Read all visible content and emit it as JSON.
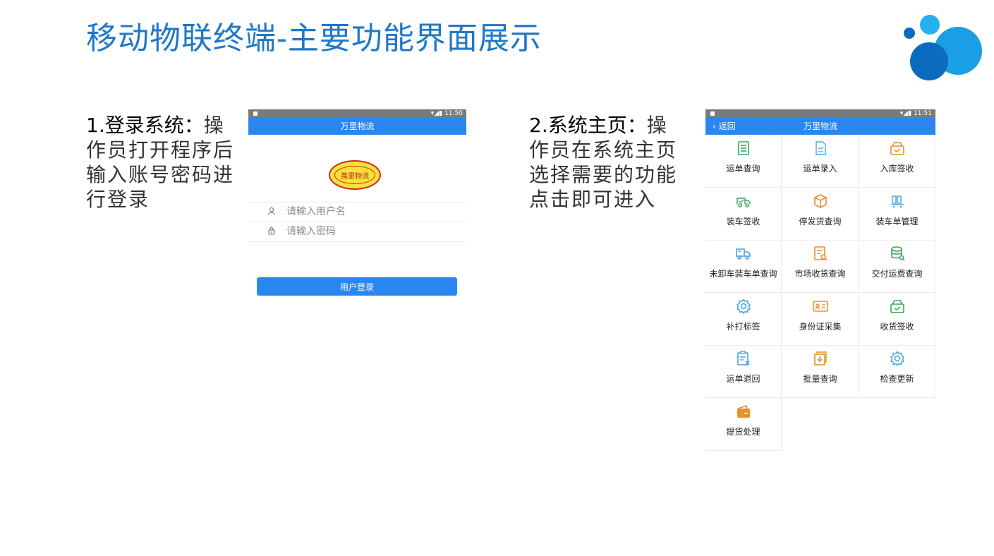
{
  "slide": {
    "title": "移动物联终端-主要功能界面展示"
  },
  "logo": {
    "colors": [
      "#1a9ee6",
      "#0a6bbf",
      "#27b0ef"
    ]
  },
  "section1": {
    "lead": "1.登录系统：",
    "text": "操作员打开程序后输入账号密码进行登录"
  },
  "section2": {
    "lead": "2.系统主页：",
    "text": "操作员在系统主页选择需要的功能点击即可进入"
  },
  "login_screen": {
    "status_time": "11:50",
    "app_title": "万里物流",
    "stamp_text": "萬里物流",
    "username_placeholder": "请输入用户名",
    "password_placeholder": "请输入密码",
    "login_button": "用户登录"
  },
  "home_screen": {
    "status_time": "11:51",
    "back_label": "返回",
    "app_title": "万里物流",
    "menu": [
      {
        "label": "运单查询",
        "icon": "document-list-icon",
        "color": "#3aa55a"
      },
      {
        "label": "运单录入",
        "icon": "document-edit-icon",
        "color": "#4aa3df"
      },
      {
        "label": "入库签收",
        "icon": "inbox-check-icon",
        "color": "#e8902a"
      },
      {
        "label": "装车签收",
        "icon": "truck-check-icon",
        "color": "#3aa55a"
      },
      {
        "label": "停发货查询",
        "icon": "box-icon",
        "color": "#e8902a"
      },
      {
        "label": "装车单管理",
        "icon": "cart-icon",
        "color": "#4aa3df"
      },
      {
        "label": "未卸车装车单查询",
        "icon": "delivery-truck-icon",
        "color": "#4aa3df"
      },
      {
        "label": "市场收货查询",
        "icon": "document-search-icon",
        "color": "#e8902a"
      },
      {
        "label": "交付运费查询",
        "icon": "database-search-icon",
        "color": "#3aa55a"
      },
      {
        "label": "补打标签",
        "icon": "gear-icon",
        "color": "#4aa3df"
      },
      {
        "label": "身份证采集",
        "icon": "id-card-icon",
        "color": "#e8902a"
      },
      {
        "label": "收货签收",
        "icon": "inbox-check-icon",
        "color": "#3aa55a"
      },
      {
        "label": "运单退回",
        "icon": "clipboard-x-icon",
        "color": "#4aa3df"
      },
      {
        "label": "批量查询",
        "icon": "download-box-icon",
        "color": "#e8902a"
      },
      {
        "label": "检查更新",
        "icon": "gear-icon",
        "color": "#4aa3df"
      },
      {
        "label": "提货处理",
        "icon": "wallet-icon",
        "color": "#e8902a"
      }
    ]
  }
}
